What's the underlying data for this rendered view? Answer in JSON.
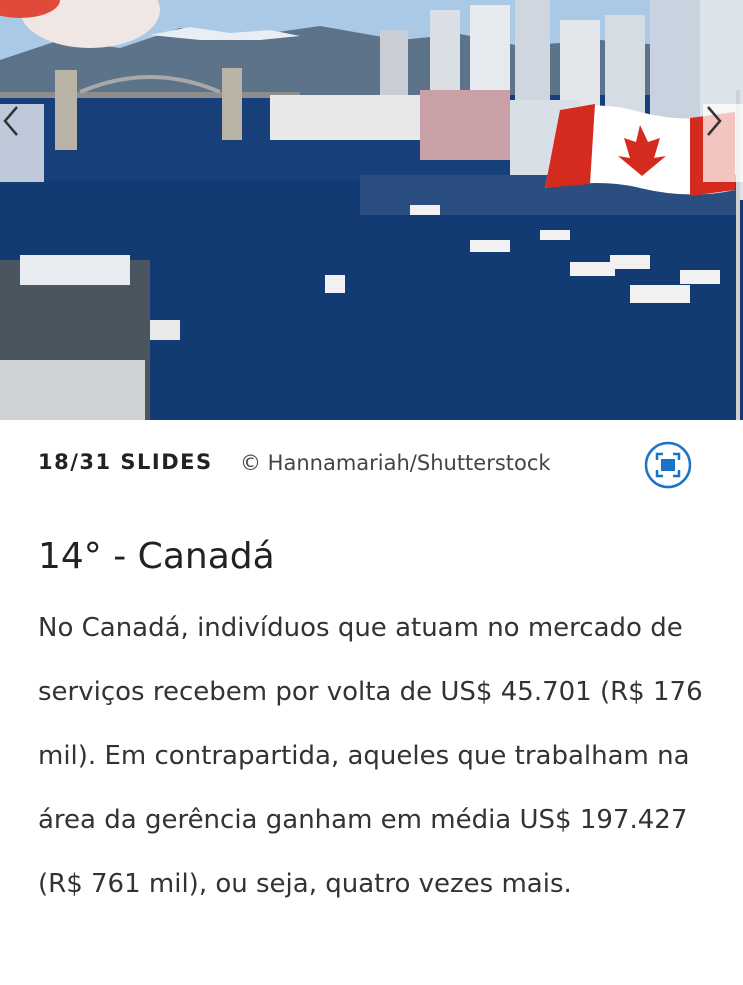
{
  "slide": {
    "counter": "18/31 SLIDES",
    "credit": "© Hannamariah/Shutterstock",
    "title": "14°  - Canadá",
    "body": "No Canadá, indivíduos que atuam no mercado de serviços recebem por volta de US$ 45.701 (R$ 176 mil). Em contrapartida, aqueles que trabalham na área da gerência ganham em média US$ 197.427 (R$ 761 mil), ou seja, quatro vezes mais."
  },
  "icons": {
    "prev": "chevron-left-icon",
    "next": "chevron-right-icon",
    "fullscreen": "fullscreen-icon"
  },
  "colors": {
    "accent": "#1a73c8",
    "water": "#173f7a",
    "flag_red": "#d52b1e"
  }
}
